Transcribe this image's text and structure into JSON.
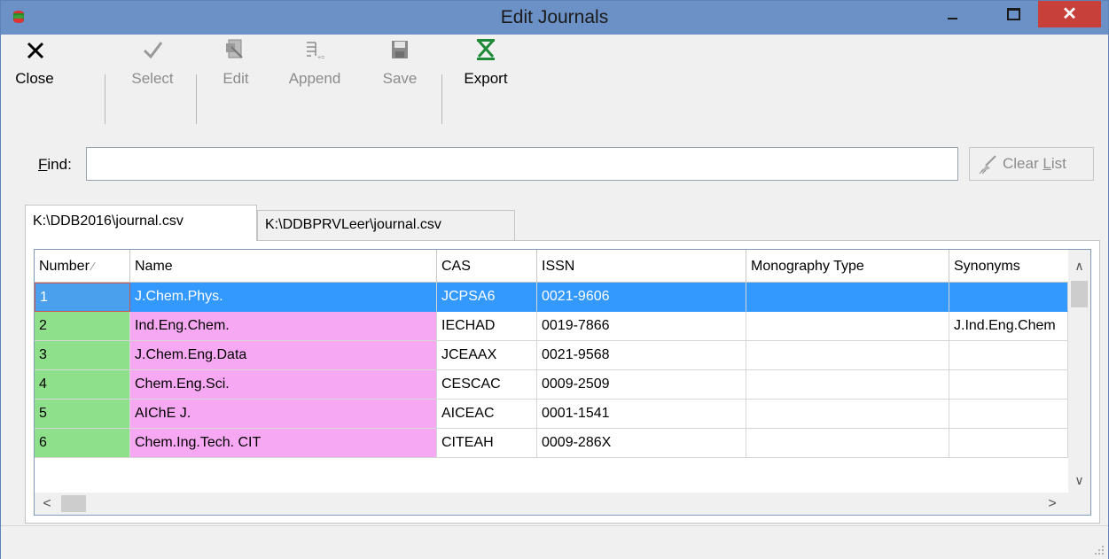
{
  "window": {
    "title": "Edit Journals",
    "close_glyph": "✕"
  },
  "toolbar": {
    "close_label": "Close",
    "select_label": "Select",
    "edit_label": "Edit",
    "append_label": "Append",
    "save_label": "Save",
    "export_label": "Export"
  },
  "find": {
    "label_prefix": "",
    "label_underlined": "F",
    "label_rest": "ind:",
    "value": ""
  },
  "clear_list": {
    "label_prefix": "Clear ",
    "label_underlined": "L",
    "label_rest": "ist"
  },
  "tabs": [
    {
      "label": "K:\\DDB2016\\journal.csv",
      "active": true
    },
    {
      "label": "K:\\DDBPRVLeer\\journal.csv",
      "active": false
    }
  ],
  "table": {
    "columns": [
      "Number",
      "Name",
      "CAS",
      "ISSN",
      "Monography Type",
      "Synonyms"
    ],
    "sort_indicator": "∕",
    "rows": [
      [
        "1",
        "J.Chem.Phys.",
        "JCPSA6",
        "0021-9606",
        "",
        ""
      ],
      [
        "2",
        "Ind.Eng.Chem.",
        "IECHAD",
        "0019-7866",
        "",
        "J.Ind.Eng.Chem"
      ],
      [
        "3",
        "J.Chem.Eng.Data",
        "JCEAAX",
        "0021-9568",
        "",
        ""
      ],
      [
        "4",
        "Chem.Eng.Sci.",
        "CESCAC",
        "0009-2509",
        "",
        ""
      ],
      [
        "5",
        "AIChE J.",
        "AICEAC",
        "0001-1541",
        "",
        ""
      ],
      [
        "6",
        "Chem.Ing.Tech. CIT",
        "CITEAH",
        "0009-286X",
        "",
        ""
      ]
    ],
    "selected_row": 0
  },
  "colors": {
    "title_bar": "#6b91c6",
    "close_button": "#c7413a",
    "number_cell": "#8ee08a",
    "name_cell": "#f7a8f2",
    "selection": "#3399ff"
  }
}
